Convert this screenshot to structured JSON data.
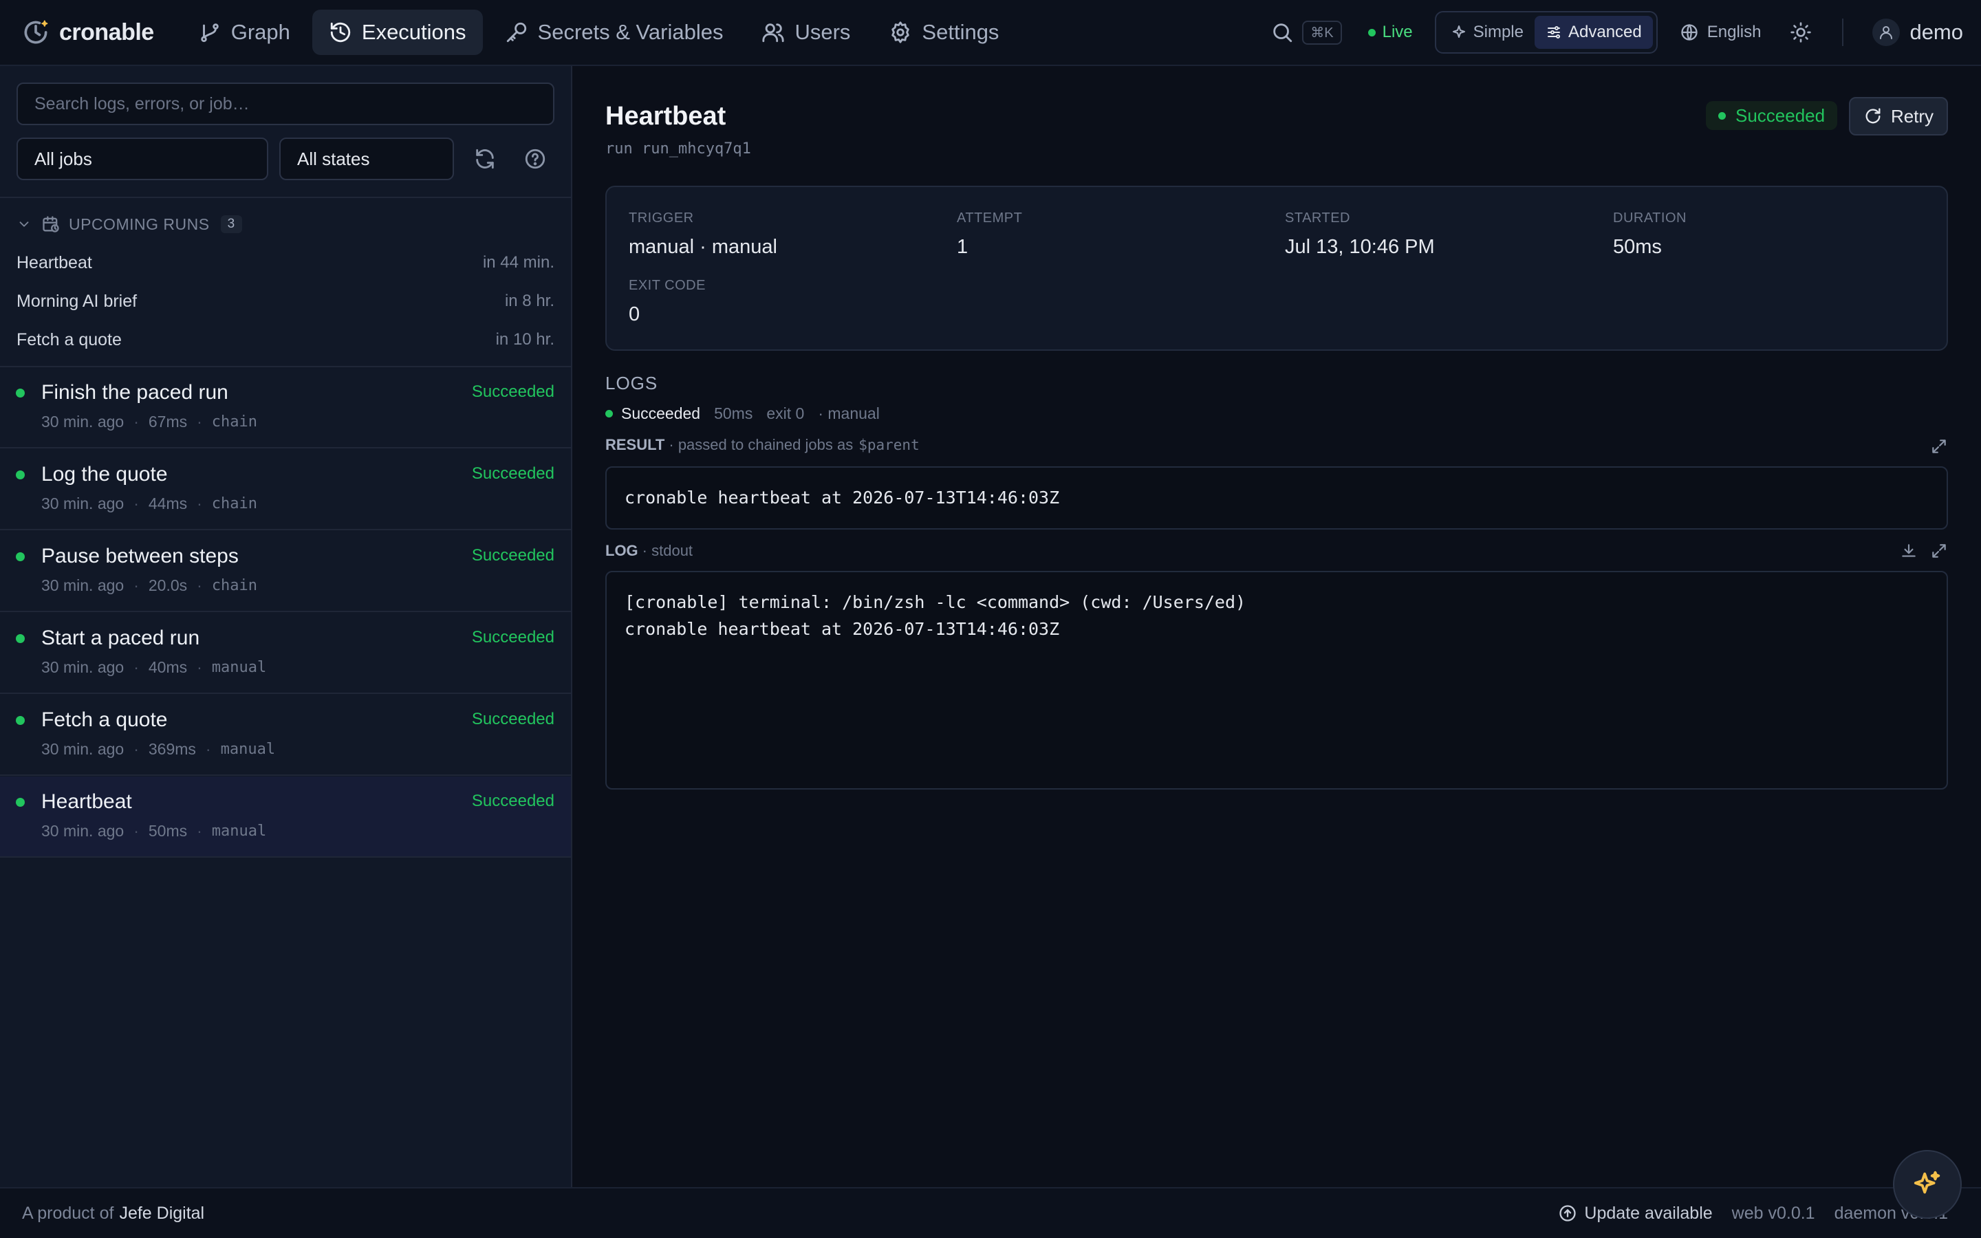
{
  "brand": {
    "name": "cronable"
  },
  "nav": {
    "items": [
      {
        "label": "Graph",
        "icon": "branch-icon",
        "active": false
      },
      {
        "label": "Executions",
        "icon": "history-icon",
        "active": true
      },
      {
        "label": "Secrets & Variables",
        "icon": "key-icon",
        "active": false
      },
      {
        "label": "Users",
        "icon": "users-icon",
        "active": false
      },
      {
        "label": "Settings",
        "icon": "gear-icon",
        "active": false
      }
    ]
  },
  "topbar": {
    "search_shortcut": "⌘K",
    "live_label": "Live",
    "mode": {
      "simple_label": "Simple",
      "advanced_label": "Advanced",
      "selected": "Advanced"
    },
    "language": "English",
    "user_name": "demo"
  },
  "sidebar": {
    "search_placeholder": "Search logs, errors, or job…",
    "job_filter": "All jobs",
    "state_filter": "All states",
    "upcoming": {
      "title": "UPCOMING RUNS",
      "count": "3",
      "items": [
        {
          "name": "Heartbeat",
          "when": "in 44 min."
        },
        {
          "name": "Morning AI brief",
          "when": "in 8 hr."
        },
        {
          "name": "Fetch a quote",
          "when": "in 10 hr."
        }
      ]
    },
    "runs": [
      {
        "name": "Finish the paced run",
        "ago": "30 min. ago",
        "duration": "67ms",
        "trigger": "chain",
        "status": "Succeeded"
      },
      {
        "name": "Log the quote",
        "ago": "30 min. ago",
        "duration": "44ms",
        "trigger": "chain",
        "status": "Succeeded"
      },
      {
        "name": "Pause between steps",
        "ago": "30 min. ago",
        "duration": "20.0s",
        "trigger": "chain",
        "status": "Succeeded"
      },
      {
        "name": "Start a paced run",
        "ago": "30 min. ago",
        "duration": "40ms",
        "trigger": "manual",
        "status": "Succeeded"
      },
      {
        "name": "Fetch a quote",
        "ago": "30 min. ago",
        "duration": "369ms",
        "trigger": "manual",
        "status": "Succeeded"
      },
      {
        "name": "Heartbeat",
        "ago": "30 min. ago",
        "duration": "50ms",
        "trigger": "manual",
        "status": "Succeeded",
        "selected": true
      }
    ]
  },
  "detail": {
    "title": "Heartbeat",
    "run_id": "run run_mhcyq7q1",
    "status": "Succeeded",
    "retry_label": "Retry",
    "info": {
      "trigger_label": "TRIGGER",
      "trigger_value": "manual · manual",
      "attempt_label": "ATTEMPT",
      "attempt_value": "1",
      "started_label": "STARTED",
      "started_value": "Jul 13, 10:46 PM",
      "duration_label": "DURATION",
      "duration_value": "50ms",
      "exit_label": "EXIT CODE",
      "exit_value": "0"
    },
    "logs": {
      "title": "LOGS",
      "summary_status": "Succeeded",
      "summary_duration": "50ms",
      "summary_exit": "exit 0",
      "summary_trigger": "· manual",
      "result_label": "RESULT",
      "result_note": "· passed to chained jobs as",
      "result_var": "$parent",
      "result_text": "cronable heartbeat at 2026-07-13T14:46:03Z",
      "log_label": "LOG",
      "log_stream": "· stdout",
      "log_text": "[cronable] terminal: /bin/zsh -lc <command> (cwd: /Users/ed)\ncronable heartbeat at 2026-07-13T14:46:03Z"
    }
  },
  "footer": {
    "product_prefix": "A product of",
    "product_name": "Jefe Digital",
    "update_label": "Update available",
    "web_version": "web v0.0.1",
    "daemon_version": "daemon v0.0.1"
  },
  "colors": {
    "accent_success": "#22c55e",
    "selected_row": "#161c36",
    "background": "#0b0f19"
  }
}
